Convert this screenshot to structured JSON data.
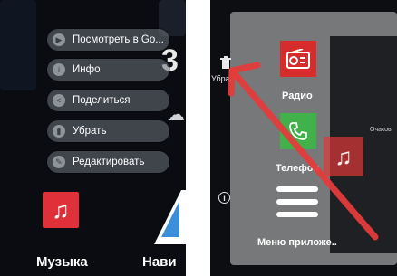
{
  "colors": {
    "accent_red": "#e0313a",
    "phone_green": "#41b24a",
    "arrow_red": "#e53b3b"
  },
  "left": {
    "context_menu": [
      {
        "label": "Посмотреть в Go...",
        "icon": "play-store-icon"
      },
      {
        "label": "Инфо",
        "icon": "info-icon"
      },
      {
        "label": "Поделиться",
        "icon": "share-icon"
      },
      {
        "label": "Убрать",
        "icon": "remove-icon"
      },
      {
        "label": "Редактировать",
        "icon": "edit-icon"
      }
    ],
    "app_music": {
      "label": "Музыка",
      "icon": "music-note-icon"
    },
    "app_navigation": {
      "label": "Нави",
      "icon": "navigation-icon"
    }
  },
  "right": {
    "remove_target": {
      "label": "Убра",
      "icon": "trash-icon"
    },
    "info_icon": "info-icon",
    "tiles": [
      {
        "label": "Радио",
        "icon": "radio-icon"
      },
      {
        "label": "Телефон",
        "icon": "phone-icon"
      },
      {
        "label": "Меню приложе..",
        "icon": "menu-icon"
      }
    ],
    "side_text": "Очаков"
  }
}
